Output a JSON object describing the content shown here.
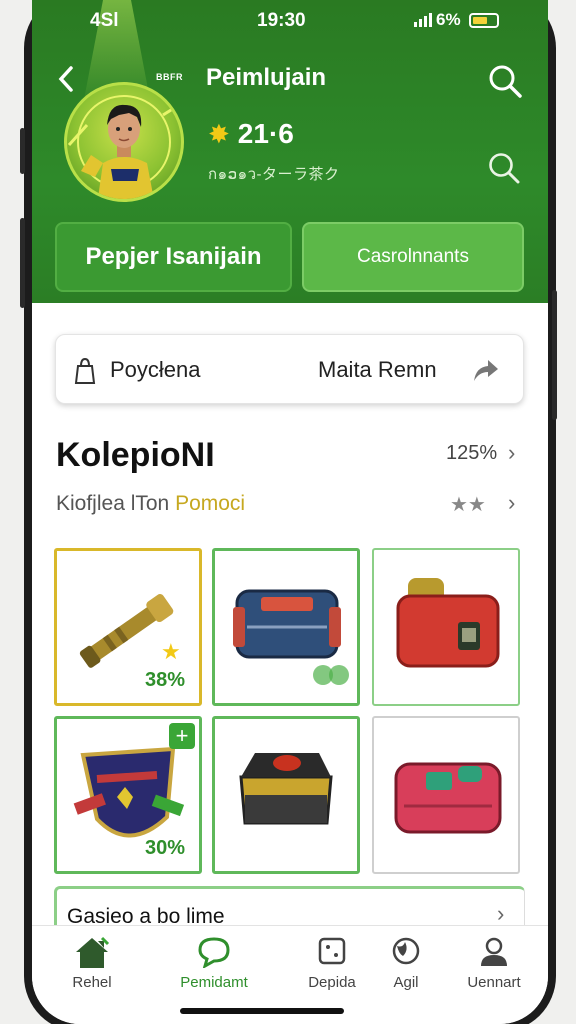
{
  "status_bar": {
    "left": "4Sl",
    "time": "19:30",
    "battery": "6%"
  },
  "profile": {
    "tag": "BBFR",
    "name": "Peimlujain",
    "score": "21·6",
    "code": "ก๑ວ๑ว-ターラ茶ク"
  },
  "tabs": {
    "primary": "Pepjer Isanijain",
    "secondary": "Casrolnnants"
  },
  "info_card": {
    "label": "Poycłena",
    "meta": "Maita Remn"
  },
  "section": {
    "title": "KolepioNI",
    "percent": "125%",
    "subtitle": "Kiofjlea lTon",
    "promo": "Pomoci"
  },
  "tiles": [
    {
      "pct": "38%"
    },
    {
      "pct": ""
    },
    {
      "pct": ""
    },
    {
      "pct": "30%"
    },
    {
      "pct": ""
    },
    {
      "pct": ""
    }
  ],
  "banner": {
    "text": "Gasieo a bo lime"
  },
  "nav": [
    {
      "label": "Rehel",
      "icon": "home-icon"
    },
    {
      "label": "Pemidamt",
      "icon": "chat-icon"
    },
    {
      "label": "Depida",
      "icon": "dice-icon"
    },
    {
      "label": "Agil",
      "icon": "globe-icon"
    },
    {
      "label": "Uennart",
      "icon": "user-icon"
    }
  ],
  "colors": {
    "brand_green": "#2e8a2a",
    "accent_gold": "#d9b82a",
    "active_nav": "#2f8f2c"
  }
}
